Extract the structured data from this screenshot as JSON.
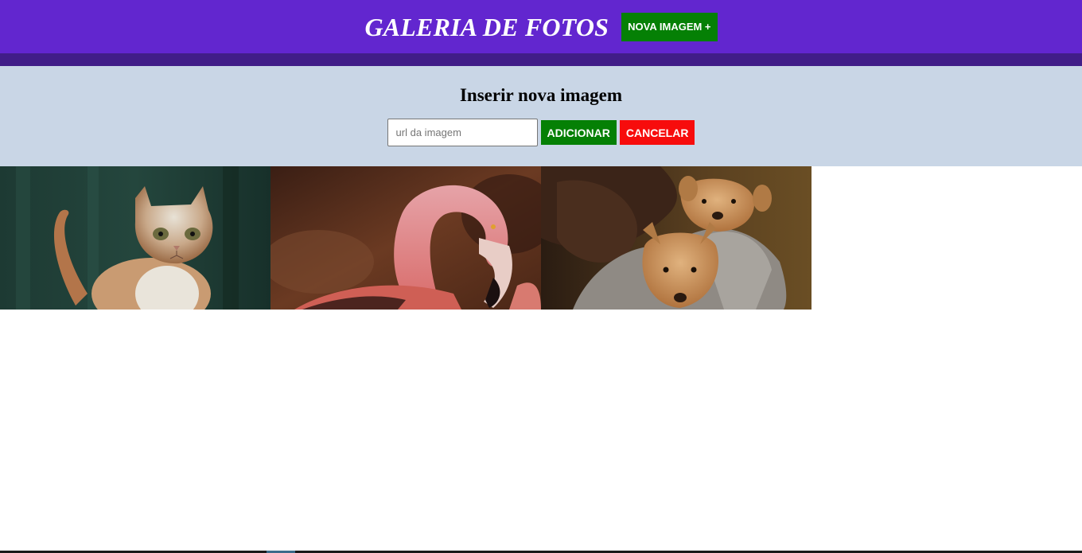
{
  "header": {
    "title": "GALERIA DE FOTOS",
    "new_image_button": "NOVA IMAGEM +"
  },
  "form": {
    "title": "Inserir nova imagem",
    "url_placeholder": "url da imagem",
    "url_value": "",
    "add_button": "ADICIONAR",
    "cancel_button": "CANCELAR"
  },
  "gallery": {
    "images": [
      {
        "subject": "cat"
      },
      {
        "subject": "flamingo"
      },
      {
        "subject": "puppies"
      }
    ]
  },
  "colors": {
    "header_bg": "#6226cf",
    "header_strip": "#411d88",
    "form_bg": "#c9d6e6",
    "green": "#058005",
    "red": "#f70c0c"
  }
}
